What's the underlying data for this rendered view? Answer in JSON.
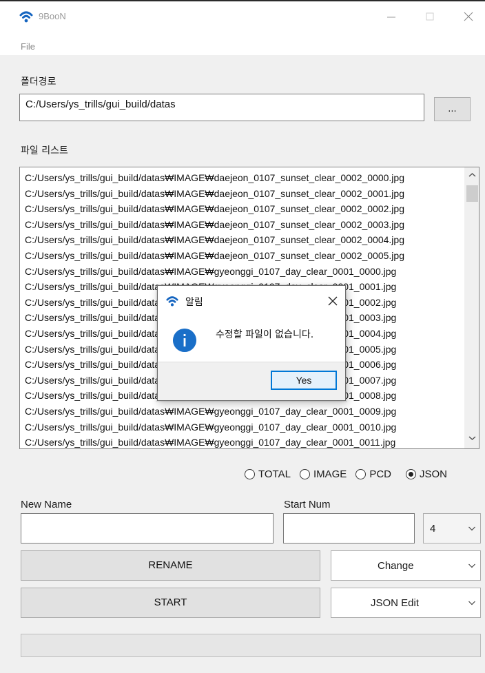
{
  "window": {
    "title": "9BooN",
    "menu": [
      "File"
    ]
  },
  "folder": {
    "label": "폴더경로",
    "path": "C:/Users/ys_trills/gui_build/datas",
    "browse_label": "..."
  },
  "file_list": {
    "label": "파일 리스트",
    "items": [
      "C:/Users/ys_trills/gui_build/datas₩IMAGE₩daejeon_0107_sunset_clear_0002_0000.jpg",
      "C:/Users/ys_trills/gui_build/datas₩IMAGE₩daejeon_0107_sunset_clear_0002_0001.jpg",
      "C:/Users/ys_trills/gui_build/datas₩IMAGE₩daejeon_0107_sunset_clear_0002_0002.jpg",
      "C:/Users/ys_trills/gui_build/datas₩IMAGE₩daejeon_0107_sunset_clear_0002_0003.jpg",
      "C:/Users/ys_trills/gui_build/datas₩IMAGE₩daejeon_0107_sunset_clear_0002_0004.jpg",
      "C:/Users/ys_trills/gui_build/datas₩IMAGE₩daejeon_0107_sunset_clear_0002_0005.jpg",
      "C:/Users/ys_trills/gui_build/datas₩IMAGE₩gyeonggi_0107_day_clear_0001_0000.jpg",
      "C:/Users/ys_trills/gui_build/datas₩IMAGE₩gyeonggi_0107_day_clear_0001_0001.jpg",
      "C:/Users/ys_trills/gui_build/datas₩IMAGE₩gyeonggi_0107_day_clear_0001_0002.jpg",
      "C:/Users/ys_trills/gui_build/datas₩IMAGE₩gyeonggi_0107_day_clear_0001_0003.jpg",
      "C:/Users/ys_trills/gui_build/datas₩IMAGE₩gyeonggi_0107_day_clear_0001_0004.jpg",
      "C:/Users/ys_trills/gui_build/datas₩IMAGE₩gyeonggi_0107_day_clear_0001_0005.jpg",
      "C:/Users/ys_trills/gui_build/datas₩IMAGE₩gyeonggi_0107_day_clear_0001_0006.jpg",
      "C:/Users/ys_trills/gui_build/datas₩IMAGE₩gyeonggi_0107_day_clear_0001_0007.jpg",
      "C:/Users/ys_trills/gui_build/datas₩IMAGE₩gyeonggi_0107_day_clear_0001_0008.jpg",
      "C:/Users/ys_trills/gui_build/datas₩IMAGE₩gyeonggi_0107_day_clear_0001_0009.jpg",
      "C:/Users/ys_trills/gui_build/datas₩IMAGE₩gyeonggi_0107_day_clear_0001_0010.jpg",
      "C:/Users/ys_trills/gui_build/datas₩IMAGE₩gyeonggi_0107_day_clear_0001_0011.jpg"
    ]
  },
  "filter": {
    "options": [
      "TOTAL",
      "IMAGE",
      "PCD",
      "JSON"
    ],
    "selected": "JSON"
  },
  "rename": {
    "new_name_label": "New Name",
    "new_name_value": "",
    "start_num_label": "Start Num",
    "start_num_value": "",
    "digits_value": "4",
    "rename_button": "RENAME",
    "mode_value": "Change",
    "start_button": "START",
    "action_value": "JSON Edit"
  },
  "progress": {
    "value": 0
  },
  "dialog": {
    "title": "알림",
    "message": "수정할 파일이 없습니다.",
    "yes_label": "Yes"
  },
  "colors": {
    "accent": "#0078d7",
    "info": "#1a6fc8",
    "app_icon": "#1565c0"
  }
}
